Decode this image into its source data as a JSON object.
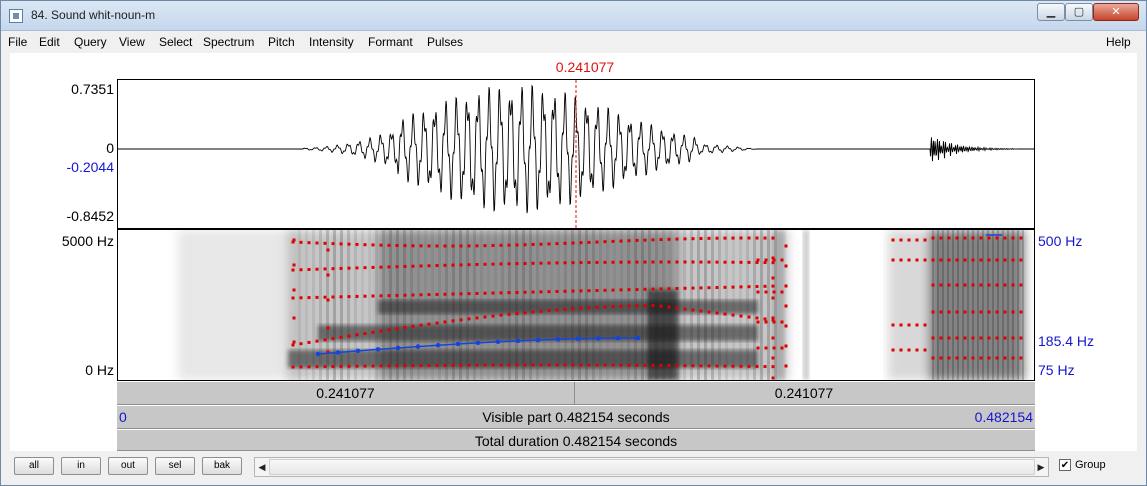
{
  "window": {
    "title": "84. Sound whit-noun-m"
  },
  "menu": [
    "File",
    "Edit",
    "Query",
    "View",
    "Select",
    "Spectrum",
    "Pitch",
    "Intensity",
    "Formant",
    "Pulses"
  ],
  "help": "Help",
  "cursor": {
    "time": "0.241077"
  },
  "waveform": {
    "ymax": "0.7351",
    "zero": "0",
    "cursor_value": "-0.2044",
    "ymin": "-0.8452"
  },
  "spectrogram": {
    "freq_max": "5000 Hz",
    "freq_min": "0 Hz",
    "pitch_max": "500 Hz",
    "pitch_value": "185.4 Hz",
    "pitch_min": "75 Hz"
  },
  "time_bar": {
    "left_part": "0.241077",
    "right_part": "0.241077"
  },
  "visible_bar": {
    "start": "0",
    "label": "Visible part 0.482154 seconds",
    "end": "0.482154"
  },
  "total_bar": {
    "label": "Total duration 0.482154 seconds"
  },
  "buttons": {
    "all": "all",
    "in": "in",
    "out": "out",
    "sel": "sel",
    "bak": "bak"
  },
  "group": {
    "label": "Group",
    "checked": true
  },
  "colors": {
    "cursor": "#e01010",
    "blue": "#1515d0",
    "formant": "#e00000",
    "pitch": "#1545e0"
  }
}
